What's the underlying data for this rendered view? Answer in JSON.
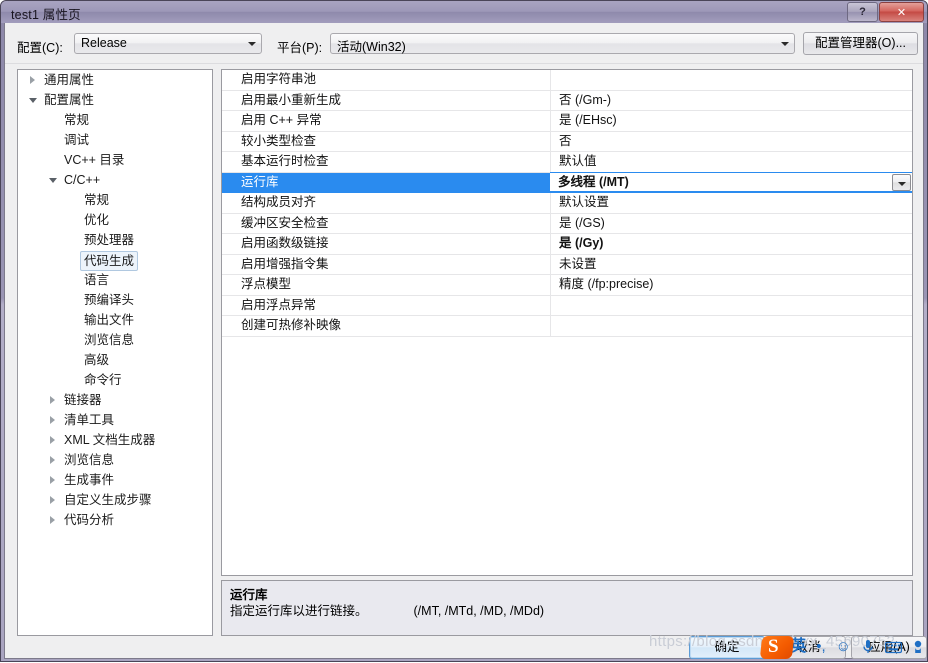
{
  "window": {
    "title": "test1 属性页",
    "help_button": "?",
    "close_button": "✕"
  },
  "configbar": {
    "configuration_label": "配置(C):",
    "configuration_value": "Release",
    "platform_label": "平台(P):",
    "platform_value": "活动(Win32)",
    "config_manager_button": "配置管理器(O)..."
  },
  "tree": {
    "items": [
      {
        "label": "通用属性",
        "indent": 0,
        "twisty": "collapsed",
        "selected": false
      },
      {
        "label": "配置属性",
        "indent": 0,
        "twisty": "expanded",
        "selected": false
      },
      {
        "label": "常规",
        "indent": 1,
        "twisty": "none",
        "selected": false
      },
      {
        "label": "调试",
        "indent": 1,
        "twisty": "none",
        "selected": false
      },
      {
        "label": "VC++ 目录",
        "indent": 1,
        "twisty": "none",
        "selected": false
      },
      {
        "label": "C/C++",
        "indent": 1,
        "twisty": "expanded",
        "selected": false
      },
      {
        "label": "常规",
        "indent": 2,
        "twisty": "none",
        "selected": false
      },
      {
        "label": "优化",
        "indent": 2,
        "twisty": "none",
        "selected": false
      },
      {
        "label": "预处理器",
        "indent": 2,
        "twisty": "none",
        "selected": false
      },
      {
        "label": "代码生成",
        "indent": 2,
        "twisty": "none",
        "selected": true
      },
      {
        "label": "语言",
        "indent": 2,
        "twisty": "none",
        "selected": false
      },
      {
        "label": "预编译头",
        "indent": 2,
        "twisty": "none",
        "selected": false
      },
      {
        "label": "输出文件",
        "indent": 2,
        "twisty": "none",
        "selected": false
      },
      {
        "label": "浏览信息",
        "indent": 2,
        "twisty": "none",
        "selected": false
      },
      {
        "label": "高级",
        "indent": 2,
        "twisty": "none",
        "selected": false
      },
      {
        "label": "命令行",
        "indent": 2,
        "twisty": "none",
        "selected": false
      },
      {
        "label": "链接器",
        "indent": 1,
        "twisty": "collapsed",
        "selected": false
      },
      {
        "label": "清单工具",
        "indent": 1,
        "twisty": "collapsed",
        "selected": false
      },
      {
        "label": "XML 文档生成器",
        "indent": 1,
        "twisty": "collapsed",
        "selected": false
      },
      {
        "label": "浏览信息",
        "indent": 1,
        "twisty": "collapsed",
        "selected": false
      },
      {
        "label": "生成事件",
        "indent": 1,
        "twisty": "collapsed",
        "selected": false
      },
      {
        "label": "自定义生成步骤",
        "indent": 1,
        "twisty": "collapsed",
        "selected": false
      },
      {
        "label": "代码分析",
        "indent": 1,
        "twisty": "collapsed",
        "selected": false
      }
    ]
  },
  "grid": {
    "rows": [
      {
        "name": "启用字符串池",
        "value": "",
        "selected": false,
        "bold": false
      },
      {
        "name": "启用最小重新生成",
        "value": "否 (/Gm-)",
        "selected": false,
        "bold": false
      },
      {
        "name": "启用 C++ 异常",
        "value": "是 (/EHsc)",
        "selected": false,
        "bold": false
      },
      {
        "name": "较小类型检查",
        "value": "否",
        "selected": false,
        "bold": false
      },
      {
        "name": "基本运行时检查",
        "value": "默认值",
        "selected": false,
        "bold": false
      },
      {
        "name": "运行库",
        "value": "多线程 (/MT)",
        "selected": true,
        "bold": true
      },
      {
        "name": "结构成员对齐",
        "value": "默认设置",
        "selected": false,
        "bold": false
      },
      {
        "name": "缓冲区安全检查",
        "value": "是 (/GS)",
        "selected": false,
        "bold": false
      },
      {
        "name": "启用函数级链接",
        "value": "是 (/Gy)",
        "selected": false,
        "bold": true
      },
      {
        "name": "启用增强指令集",
        "value": "未设置",
        "selected": false,
        "bold": false
      },
      {
        "name": "浮点模型",
        "value": "精度 (/fp:precise)",
        "selected": false,
        "bold": false
      },
      {
        "name": "启用浮点异常",
        "value": "",
        "selected": false,
        "bold": false
      },
      {
        "name": "创建可热修补映像",
        "value": "",
        "selected": false,
        "bold": false
      }
    ]
  },
  "description": {
    "title": "运行库",
    "text": "指定运行库以进行链接。",
    "switches": "(/MT, /MTd, /MD, /MDd)"
  },
  "footer": {
    "ok_button": "确定",
    "cancel_button": "取消",
    "apply_button": "应用(A)"
  },
  "overlay": {
    "watermark": "https://blog.csdn.net/xxx_45690752",
    "ime": {
      "logo_letter": "S",
      "mode": "英",
      "punctuation": "•,",
      "emoji": "☺",
      "voice": "🎤",
      "keyboard": "⌨",
      "tools": "🔧"
    }
  },
  "colors": {
    "selection_blue": "#2a8bef",
    "title_purple": "#9a95b4",
    "close_red": "#c44a44",
    "dialog_face": "#efeff0",
    "desc_face": "#e9e9ef"
  }
}
